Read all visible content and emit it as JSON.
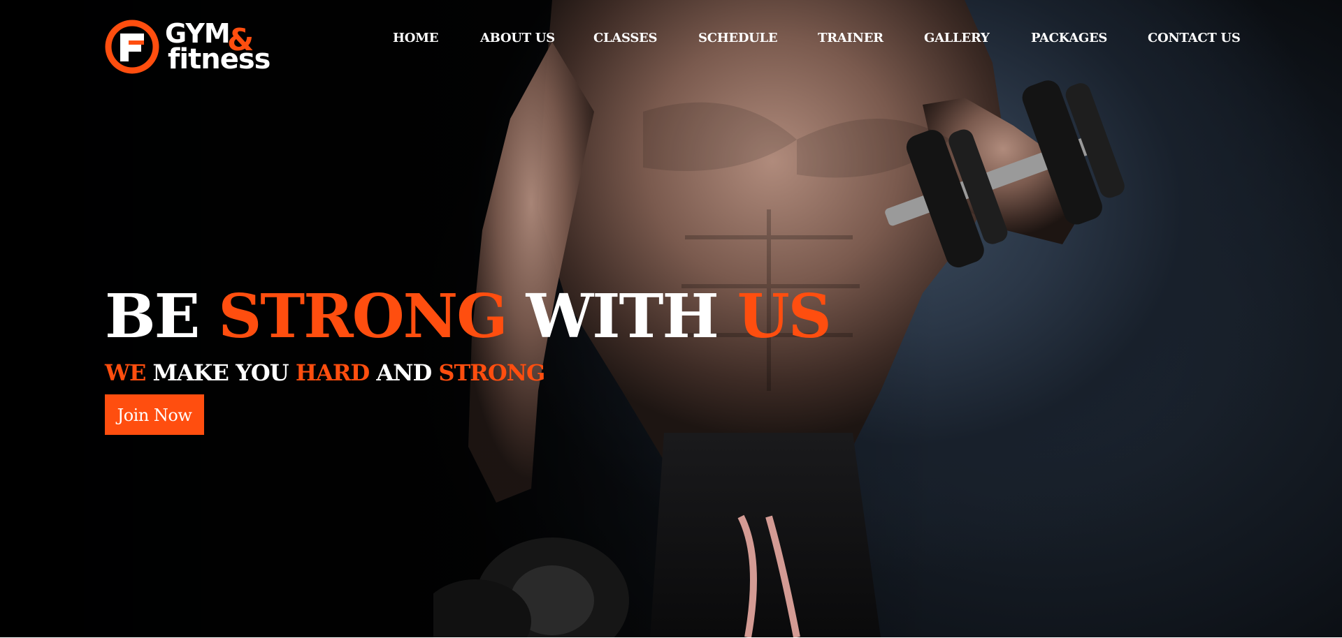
{
  "brand": {
    "logo_line1": "GYM",
    "logo_amp": "&",
    "logo_line2": "fitness",
    "accent_color": "#ff4e0f"
  },
  "nav": {
    "items": [
      {
        "label": "HOME"
      },
      {
        "label": "ABOUT US"
      },
      {
        "label": "CLASSES"
      },
      {
        "label": "SCHEDULE"
      },
      {
        "label": "TRAINER"
      },
      {
        "label": "GALLERY"
      },
      {
        "label": "PACKAGES"
      },
      {
        "label": "CONTACT US"
      }
    ]
  },
  "hero": {
    "headline": {
      "part1": "BE ",
      "part2": "STRONG",
      "part3": " WITH ",
      "part4": "US"
    },
    "subline": {
      "part1": "WE",
      "part2": " MAKE YOU ",
      "part3": "HARD",
      "part4": " AND ",
      "part5": "STRONG"
    },
    "cta_label": "Join Now",
    "background_image": "muscular-athlete-lifting-dumbbells"
  }
}
